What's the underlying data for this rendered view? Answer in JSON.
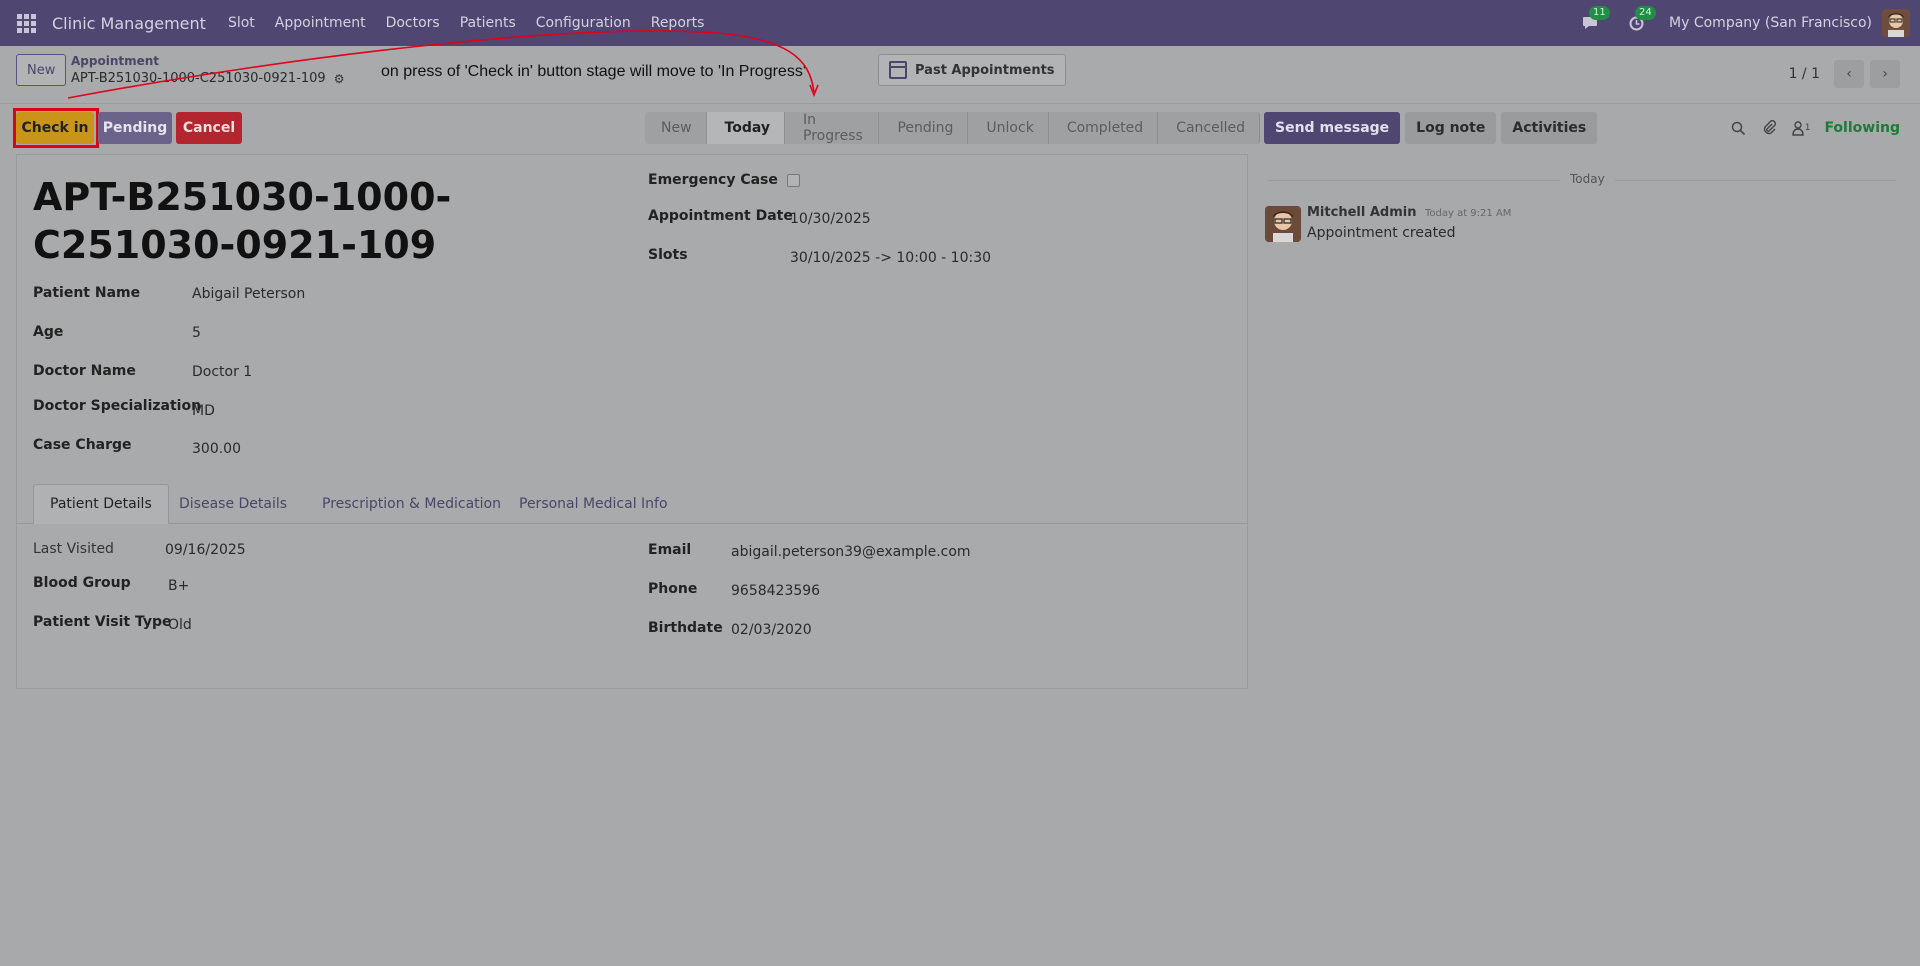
{
  "navbar": {
    "brand": "Clinic Management",
    "menu": [
      "Slot",
      "Appointment",
      "Doctors",
      "Patients",
      "Configuration",
      "Reports"
    ],
    "messages_count": "11",
    "activities_count": "24",
    "company": "My Company (San Francisco)"
  },
  "control": {
    "new_label": "New",
    "breadcrumb_parent": "Appointment",
    "breadcrumb_current": "APT-B251030-1000-C251030-0921-109",
    "annotation": "on press of 'Check in' button stage will move to 'In Progress'",
    "past_appointments": "Past Appointments",
    "pager": "1 / 1"
  },
  "actions": {
    "checkin": "Check in",
    "pending": "Pending",
    "cancel": "Cancel"
  },
  "stages": [
    "New",
    "Today",
    "In Progress",
    "Pending",
    "Unlock",
    "Completed",
    "Cancelled"
  ],
  "active_stage": "Today",
  "chatter": {
    "send_message": "Send message",
    "log_note": "Log note",
    "activities": "Activities",
    "followers_count": "1",
    "following": "Following",
    "date_separator": "Today",
    "author": "Mitchell Admin",
    "time": "Today at 9:21 AM",
    "message": "Appointment created"
  },
  "form": {
    "title": "APT-B251030-1000-C251030-0921-109",
    "patient_name_label": "Patient Name",
    "patient_name": "Abigail Peterson",
    "age_label": "Age",
    "age": "5",
    "doctor_name_label": "Doctor Name",
    "doctor_name": "Doctor 1",
    "doctor_spec_label": "Doctor Specialization",
    "doctor_spec": "MD",
    "case_charge_label": "Case Charge",
    "case_charge": "300.00",
    "emergency_label": "Emergency Case",
    "appointment_date_label": "Appointment Date",
    "appointment_date": "10/30/2025",
    "slots_label": "Slots",
    "slots": "30/10/2025 -> 10:00 - 10:30"
  },
  "tabs": [
    "Patient Details",
    "Disease Details",
    "Prescription & Medication",
    "Personal Medical Info"
  ],
  "patient_details": {
    "last_visited_label": "Last Visited",
    "last_visited": "09/16/2025",
    "blood_group_label": "Blood Group",
    "blood_group": "B+",
    "visit_type_label": "Patient Visit Type",
    "visit_type": "Old",
    "email_label": "Email",
    "email": "abigail.peterson39@example.com",
    "phone_label": "Phone",
    "phone": "9658423596",
    "birthdate_label": "Birthdate",
    "birthdate": "02/03/2020"
  },
  "colors": {
    "navbar": "#4f4672",
    "checkin": "#c8951a",
    "cancel": "#b4262f",
    "highlight": "#e3001b",
    "following": "#1e7a36"
  }
}
